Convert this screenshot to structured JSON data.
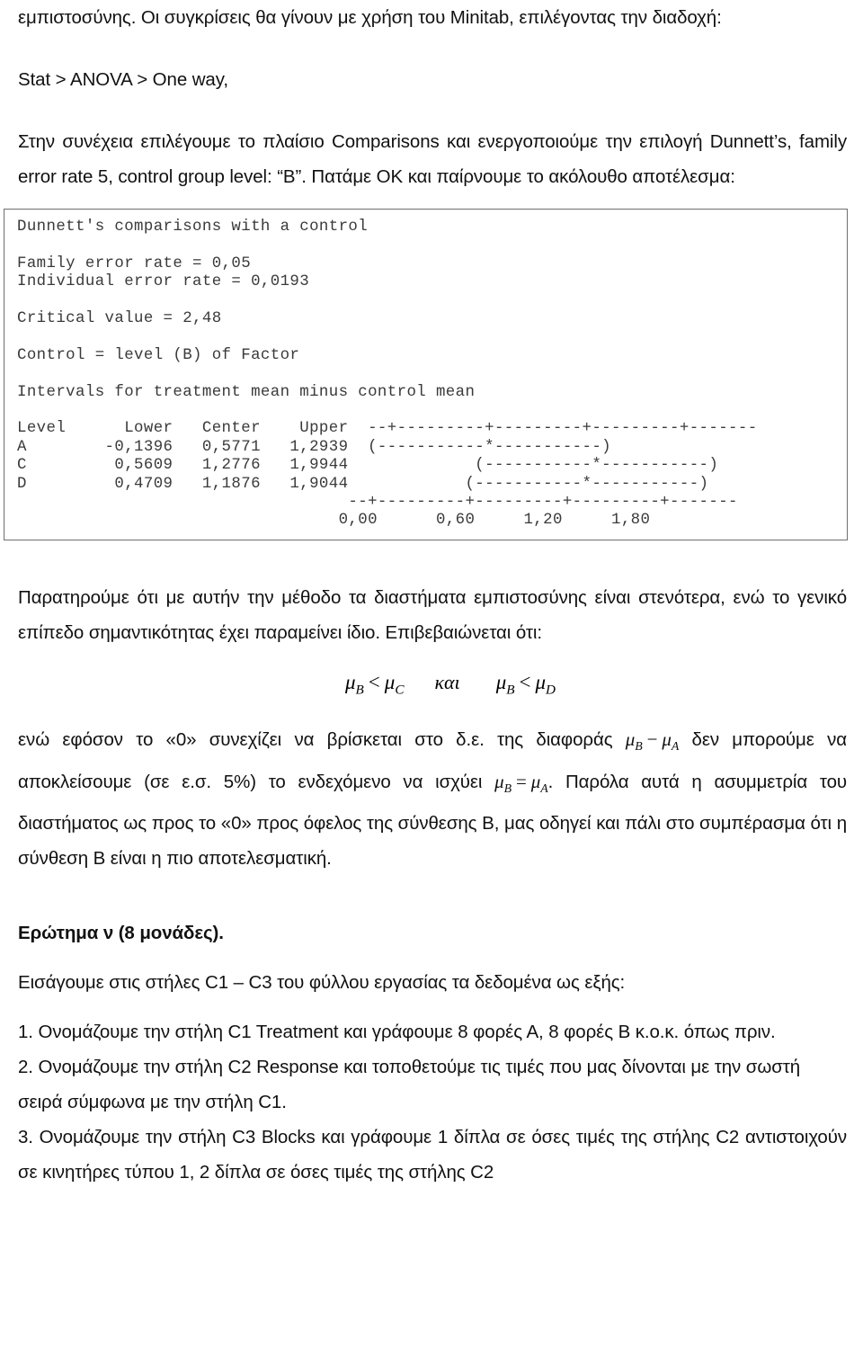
{
  "document": {
    "language": "el",
    "intro": {
      "p1": "εμπιστοσύνης. Οι συγκρίσεις θα γίνουν με χρήση του Minitab, επιλέγοντας την διαδοχή:",
      "menu_path": "Stat > ANOVA > One way,",
      "p2": "Στην συνέχεια επιλέγουμε το πλαίσιο Comparisons και ενεργοποιούμε την επιλογή Dunnett’s, family error rate 5, control group level: “B”. Πατάμε OK και παίρνουμε το ακόλουθο αποτέλεσμα:"
    },
    "minitab_output": {
      "title": "Dunnett's comparisons with a control",
      "family_error_rate": "Family error rate = 0,05",
      "individual_error_rate": "Individual error rate = 0,0193",
      "critical_value": "Critical value = 2,48",
      "control": "Control = level (B) of Factor",
      "intervals_caption": "Intervals for treatment mean minus control mean",
      "header_row": "Level      Lower   Center    Upper  --+---------+---------+---------+-------",
      "row_a": "A        -0,1396   0,5771   1,2939  (-----------*-----------)",
      "row_c": "C         0,5609   1,2776   1,9944             (-----------*-----------)",
      "row_d": "D         0,4709   1,1876   1,9044            (-----------*-----------)",
      "axis_rule": "                                  --+---------+---------+---------+-------",
      "axis_labels": "                                 0,00      0,60     1,20     1,80",
      "table": {
        "columns": [
          "Level",
          "Lower",
          "Center",
          "Upper"
        ],
        "rows": [
          {
            "level": "A",
            "lower": "-0,1396",
            "center": "0,5771",
            "upper": "1,2939"
          },
          {
            "level": "C",
            "lower": "0,5609",
            "center": "1,2776",
            "upper": "1,9944"
          },
          {
            "level": "D",
            "lower": "0,4709",
            "center": "1,1876",
            "upper": "1,9044"
          }
        ],
        "axis_ticks": [
          "0,00",
          "0,60",
          "1,20",
          "1,80"
        ]
      }
    },
    "commentary": {
      "p3": "Παρατηρούμε ότι με αυτήν την μέθοδο τα διαστήματα εμπιστοσύνης είναι στενότερα, ενώ το γενικό επίπεδο σημαντικότητας έχει παραμείνει ίδιο. Επιβεβαιώνεται ότι:",
      "formula": {
        "mu": "μ",
        "sub_b": "B",
        "sub_c": "C",
        "sub_d": "D",
        "sub_a": "A",
        "less_than": "<",
        "equals": "=",
        "minus": "−",
        "conjunction": "και"
      },
      "p4_part1": "ενώ εφόσον το «0» συνεχίζει να βρίσκεται στο δ.ε. της διαφοράς ",
      "p4_part2": " δεν μπορούμε να αποκλείσουμε (σε ε.σ. 5%) το ενδεχόμενο να ισχύει ",
      "p4_part3": ". Παρόλα αυτά η ασυμμετρία του διαστήματος ως προς το «0» προς όφελος της σύνθεσης Β, μας οδηγεί και πάλι στο συμπέρασμα ότι η σύνθεση Β είναι η πιο αποτελεσματική."
    },
    "question": {
      "heading": "Ερώτημα ν (8 μονάδες).",
      "lead_in": "Εισάγουμε στις στήλες C1 – C3 του φύλλου εργασίας τα δεδομένα ως εξής:",
      "steps": [
        "1. Ονομάζουμε την στήλη C1 Treatment και γράφουμε 8 φορές Α, 8 φορές Β κ.ο.κ. όπως πριν.",
        "2. Ονομάζουμε την στήλη C2 Response και τοποθετούμε τις τιμές που μας δίνονται με την σωστή σειρά σύμφωνα με την στήλη C1.",
        "3. Ονομάζουμε την στήλη C3 Blocks και γράφουμε 1 δίπλα σε όσες τιμές της στήλης C2 αντιστοιχούν σε κινητήρες τύπου 1, 2 δίπλα σε όσες τιμές της στήλης C2"
      ]
    }
  }
}
